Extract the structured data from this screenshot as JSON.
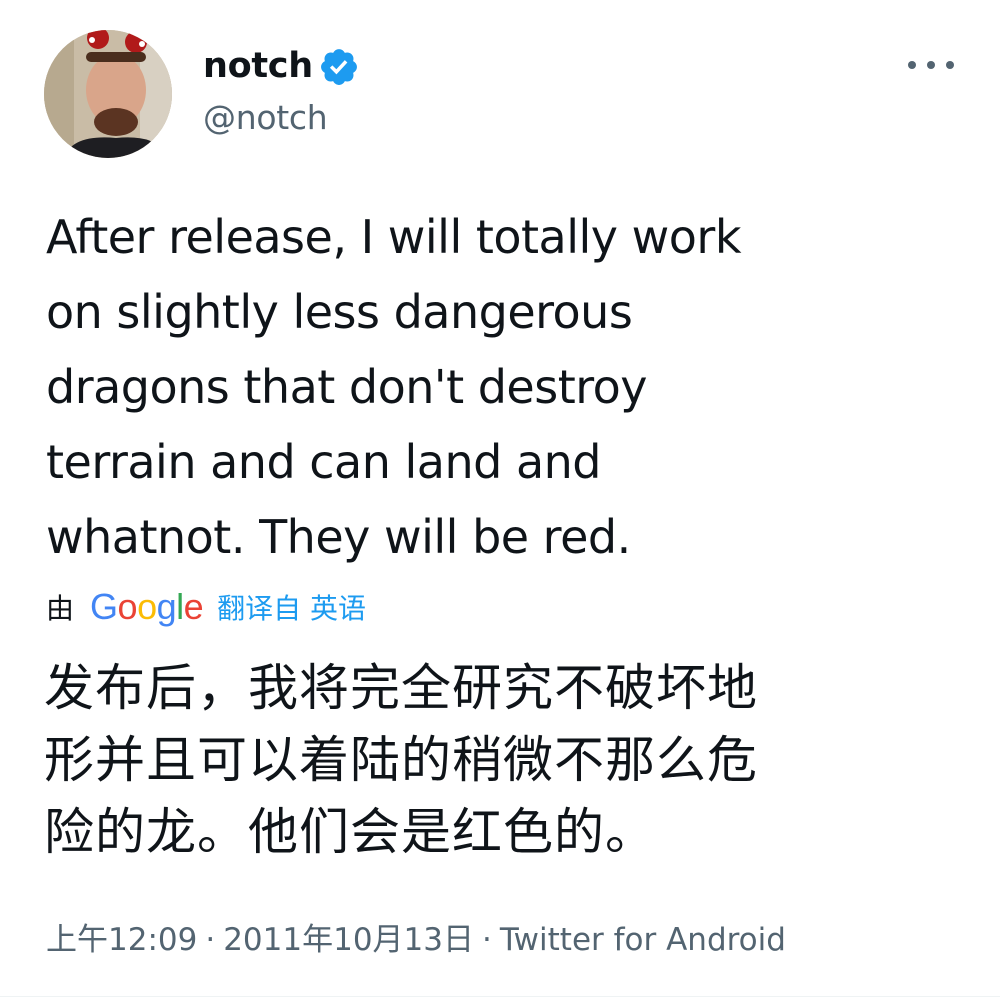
{
  "colors": {
    "accent": "#1d9bf0",
    "text_primary": "#0f1419",
    "text_secondary": "#536471"
  },
  "author": {
    "display_name": "notch",
    "handle": "@notch",
    "verified": true,
    "verified_icon": "verified-badge-icon",
    "avatar": "avatar"
  },
  "more_menu": {
    "icon": "more-horizontal-icon"
  },
  "tweet": {
    "text": "After release, I will totally work\non slightly less dangerous\ndragons that don't destroy\nterrain and can land and\nwhatnot. They will be red."
  },
  "translation": {
    "by_label": "由",
    "provider_logo": "Google",
    "from_label": "翻译自 英语",
    "text": "发布后，我将完全研究不破坏地\n形并且可以着陆的稍微不那么危\n险的龙。他们会是红色的。"
  },
  "meta": {
    "time": "上午12:09",
    "separator": "·",
    "date": "2011年10月13日",
    "source": "Twitter for Android"
  }
}
